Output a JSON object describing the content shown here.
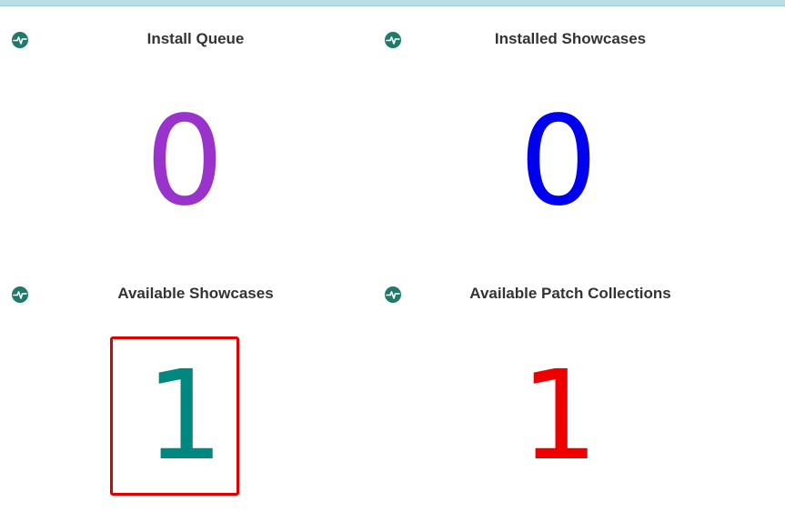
{
  "panels": [
    {
      "title": "Install Queue",
      "value": "0",
      "color": "#9933cc",
      "icon": "activity-icon"
    },
    {
      "title": "Installed Showcases",
      "value": "0",
      "color": "#0000ee",
      "icon": "activity-icon"
    },
    {
      "title": "Available Showcases",
      "value": "1",
      "color": "#00877f",
      "icon": "activity-icon"
    },
    {
      "title": "Available Patch Collections",
      "value": "1",
      "color": "#ee0000",
      "icon": "activity-icon"
    }
  ],
  "colors": {
    "icon_bg": "#1f7a6b",
    "highlight": "#e00000",
    "top_bar": "#b7dfe6"
  }
}
